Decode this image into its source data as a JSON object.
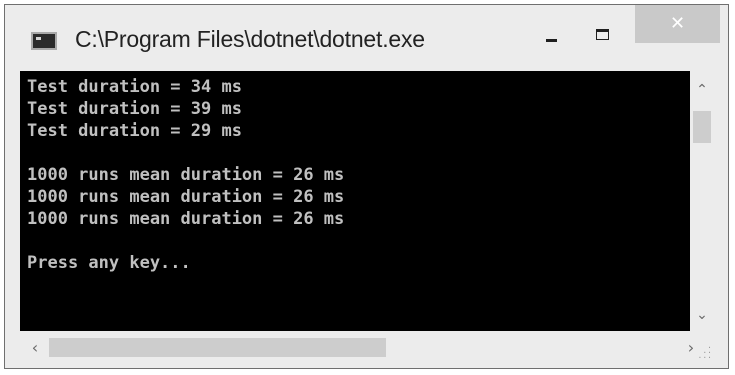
{
  "window": {
    "title": "C:\\Program Files\\dotnet\\dotnet.exe",
    "icon": "console-window-icon",
    "close_glyph": "✕"
  },
  "console": {
    "lines": [
      "Test duration = 34 ms",
      "Test duration = 39 ms",
      "Test duration = 29 ms",
      "",
      "1000 runs mean duration = 26 ms",
      "1000 runs mean duration = 26 ms",
      "1000 runs mean duration = 26 ms",
      "",
      "Press any key..."
    ],
    "background": "#000000",
    "foreground": "#c0c0c0"
  },
  "scrollbars": {
    "up_glyph": "⌃",
    "down_glyph": "⌄",
    "left_glyph": "‹",
    "right_glyph": "›"
  }
}
